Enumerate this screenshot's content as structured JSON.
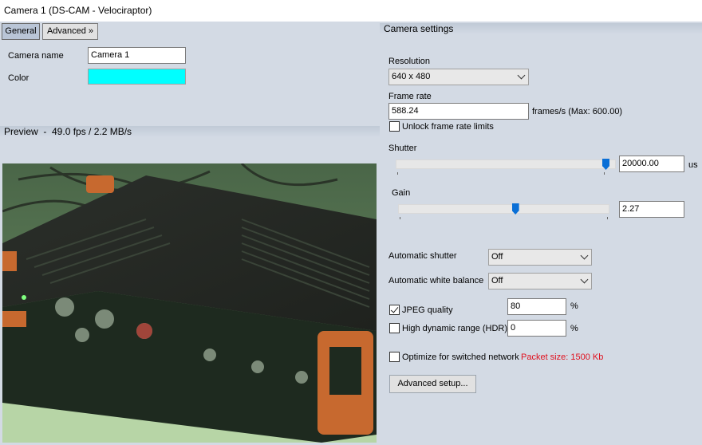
{
  "window": {
    "title": "Camera 1 (DS-CAM - Velociraptor)"
  },
  "tabs": [
    {
      "label": "General"
    },
    {
      "label": "Advanced »"
    }
  ],
  "general": {
    "camera_name_label": "Camera name",
    "camera_name_value": "Camera 1",
    "color_label": "Color",
    "color_value": "#00ffff"
  },
  "preview": {
    "header": "Preview  -  49.0 fps / 2.2 MB/s"
  },
  "camera_settings": {
    "header": "Camera settings",
    "resolution_label": "Resolution",
    "resolution_value": "640 x 480",
    "frame_rate_label": "Frame rate",
    "frame_rate_value": "588.24",
    "frame_rate_unit": "frames/s (Max: 600.00)",
    "unlock_label": "Unlock frame rate limits",
    "shutter_label": "Shutter",
    "shutter_value": "20000.00",
    "shutter_unit": "us",
    "shutter_level": 1.0,
    "gain_label": "Gain",
    "gain_value": "2.27",
    "gain_level": 0.57,
    "auto_shutter_label": "Automatic shutter",
    "auto_shutter_value": "Off",
    "auto_wb_label": "Automatic white balance",
    "auto_wb_value": "Off",
    "jpeg_label": "JPEG quality",
    "jpeg_checked": true,
    "jpeg_value": "80",
    "jpeg_unit": "%",
    "hdr_label": "High dynamic range (HDR)",
    "hdr_checked": false,
    "hdr_value": "0",
    "hdr_unit": "%",
    "optimize_label": "Optimize for switched network",
    "packet_size": "Packet size: 1500 Kb",
    "packet_color": "#e0101e",
    "advanced_setup_label": "Advanced setup..."
  }
}
